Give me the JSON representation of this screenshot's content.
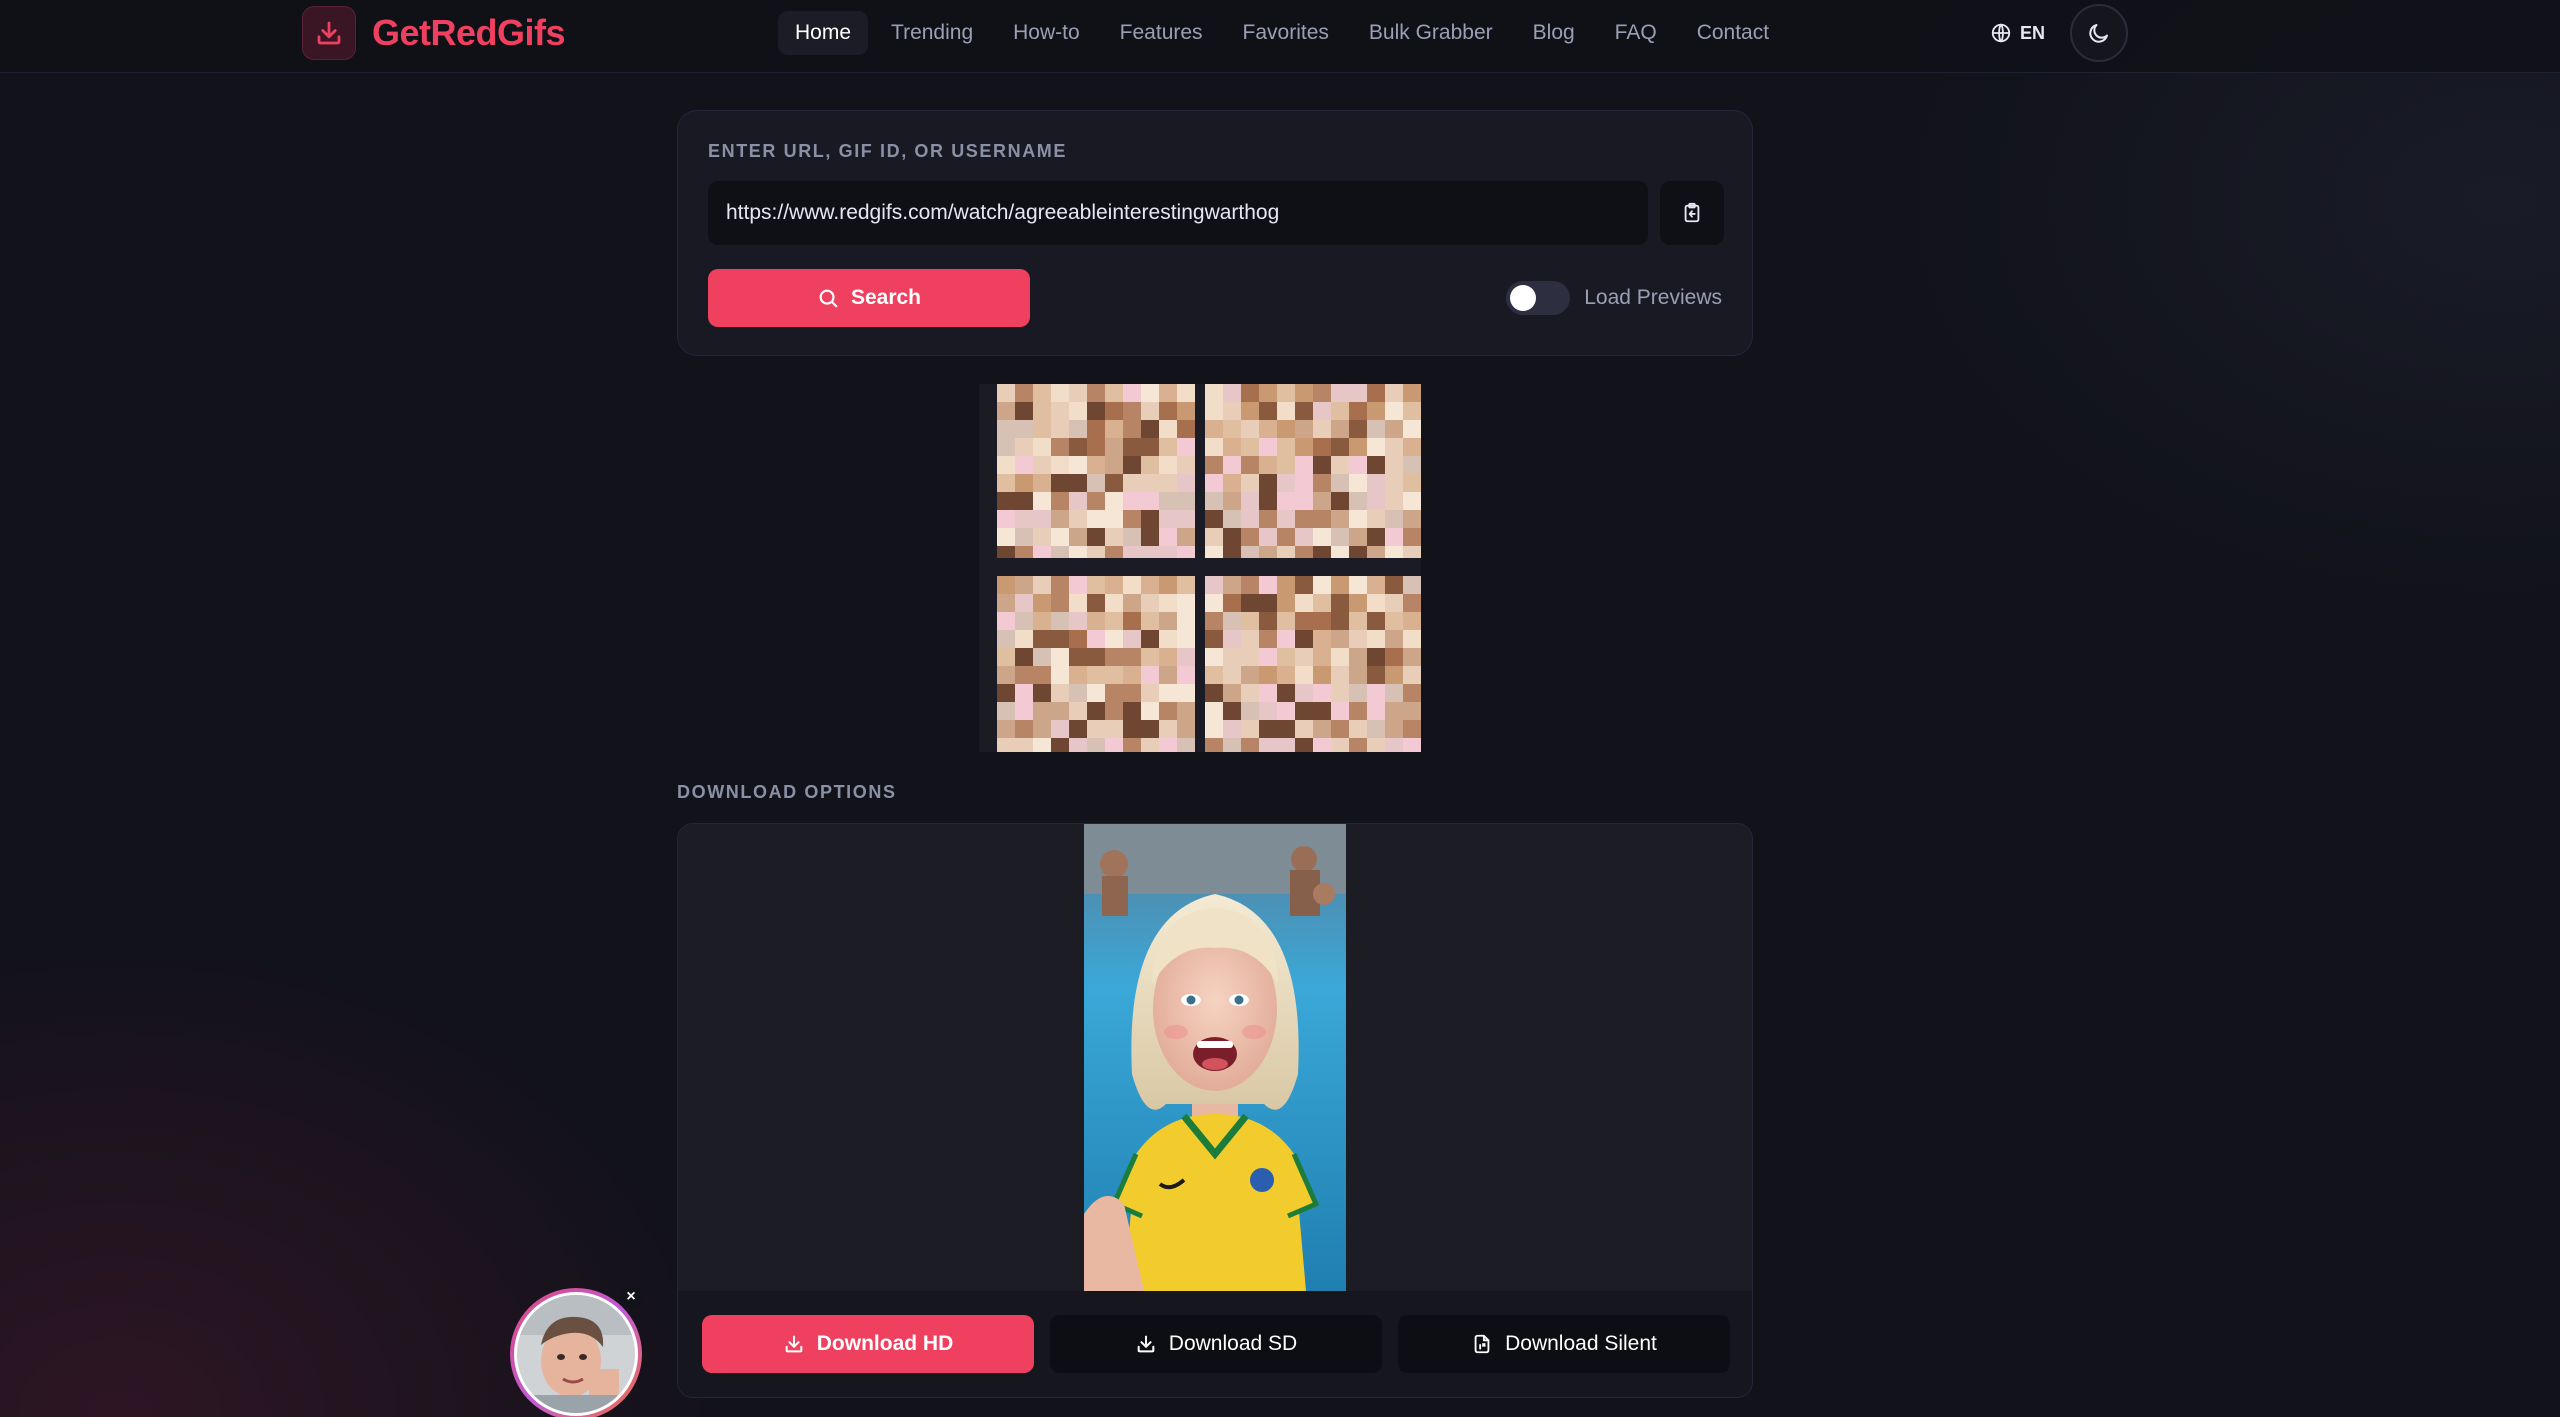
{
  "header": {
    "brand": "GetRedGifs",
    "nav": [
      {
        "label": "Home",
        "active": true
      },
      {
        "label": "Trending"
      },
      {
        "label": "How-to"
      },
      {
        "label": "Features"
      },
      {
        "label": "Favorites"
      },
      {
        "label": "Bulk Grabber"
      },
      {
        "label": "Blog"
      },
      {
        "label": "FAQ"
      },
      {
        "label": "Contact"
      }
    ],
    "language": "EN",
    "accent_color": "#f0405f"
  },
  "search": {
    "label": "ENTER URL, GIF ID, OR USERNAME",
    "value": "https://www.redgifs.com/watch/agreeableinterestingwarthog",
    "button_label": "Search",
    "toggle_label": "Load Previews",
    "toggle_on": false
  },
  "download": {
    "section_title": "DOWNLOAD OPTIONS",
    "buttons": [
      {
        "label": "Download HD",
        "icon": "download-icon"
      },
      {
        "label": "Download SD",
        "icon": "download-icon"
      },
      {
        "label": "Download Silent",
        "icon": "file-audio-off-icon"
      }
    ]
  },
  "avatar": {
    "close_glyph": "×"
  }
}
